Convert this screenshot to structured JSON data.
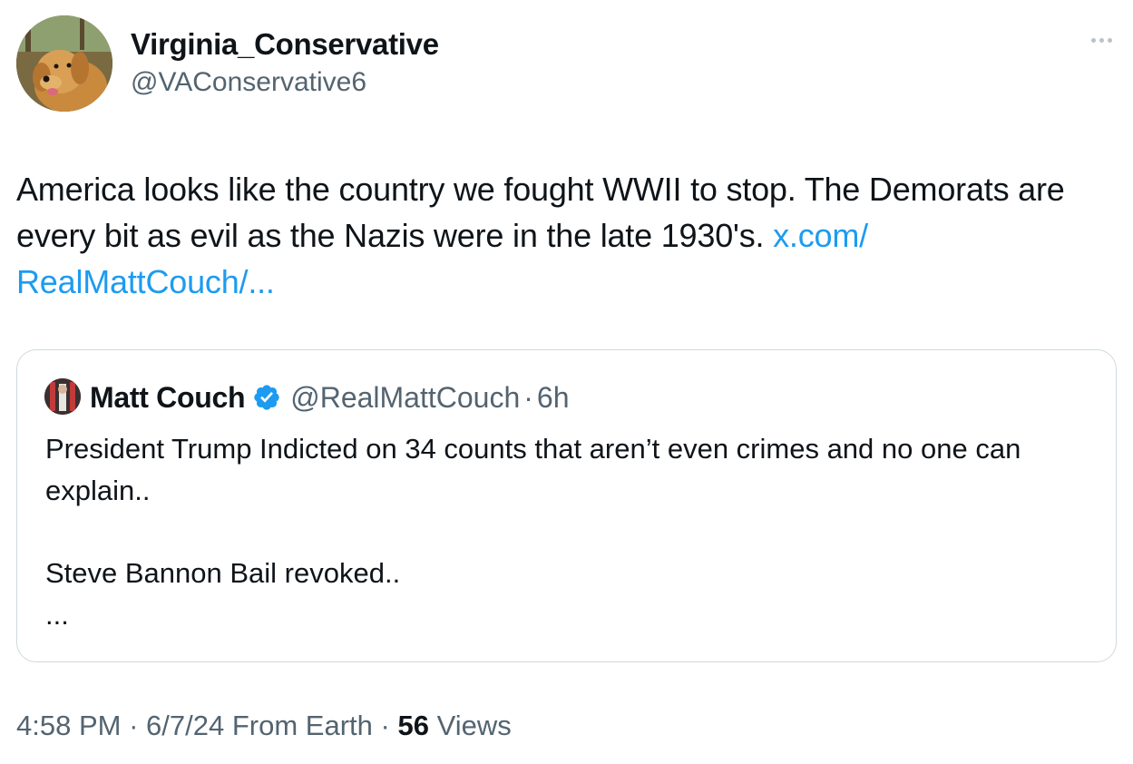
{
  "author": {
    "display_name": "Virginia_Conservative",
    "handle": "@VAConservative6",
    "avatar_icon": "golden-retriever-avatar"
  },
  "tweet": {
    "text": "America looks like the country we fought WWII to stop. The Demorats are every bit as evil as the Nazis were in the late 1930's.",
    "link_text": "x.com/\nRealMattCouch/...",
    "link_part1": "x.com/",
    "link_part2": "RealMattCouch/..."
  },
  "quote": {
    "display_name": "Matt Couch",
    "handle": "@RealMattCouch",
    "separator": "·",
    "time": "6h",
    "verified_icon": "verified-badge-icon",
    "line1": "President Trump Indicted on 34 counts that aren’t even crimes and no one can explain..",
    "line2": "Steve Bannon Bail revoked..",
    "ellipsis": "..."
  },
  "meta": {
    "time": "4:58 PM",
    "sep1": "·",
    "date": "6/7/24",
    "source": "From Earth",
    "sep2": "·",
    "views_count": "56",
    "views_label": "Views"
  },
  "colors": {
    "link": "#1d9bf0",
    "secondary_text": "#536471",
    "primary_text": "#0f1419",
    "border": "#cfd9de",
    "verified": "#1d9bf0"
  }
}
